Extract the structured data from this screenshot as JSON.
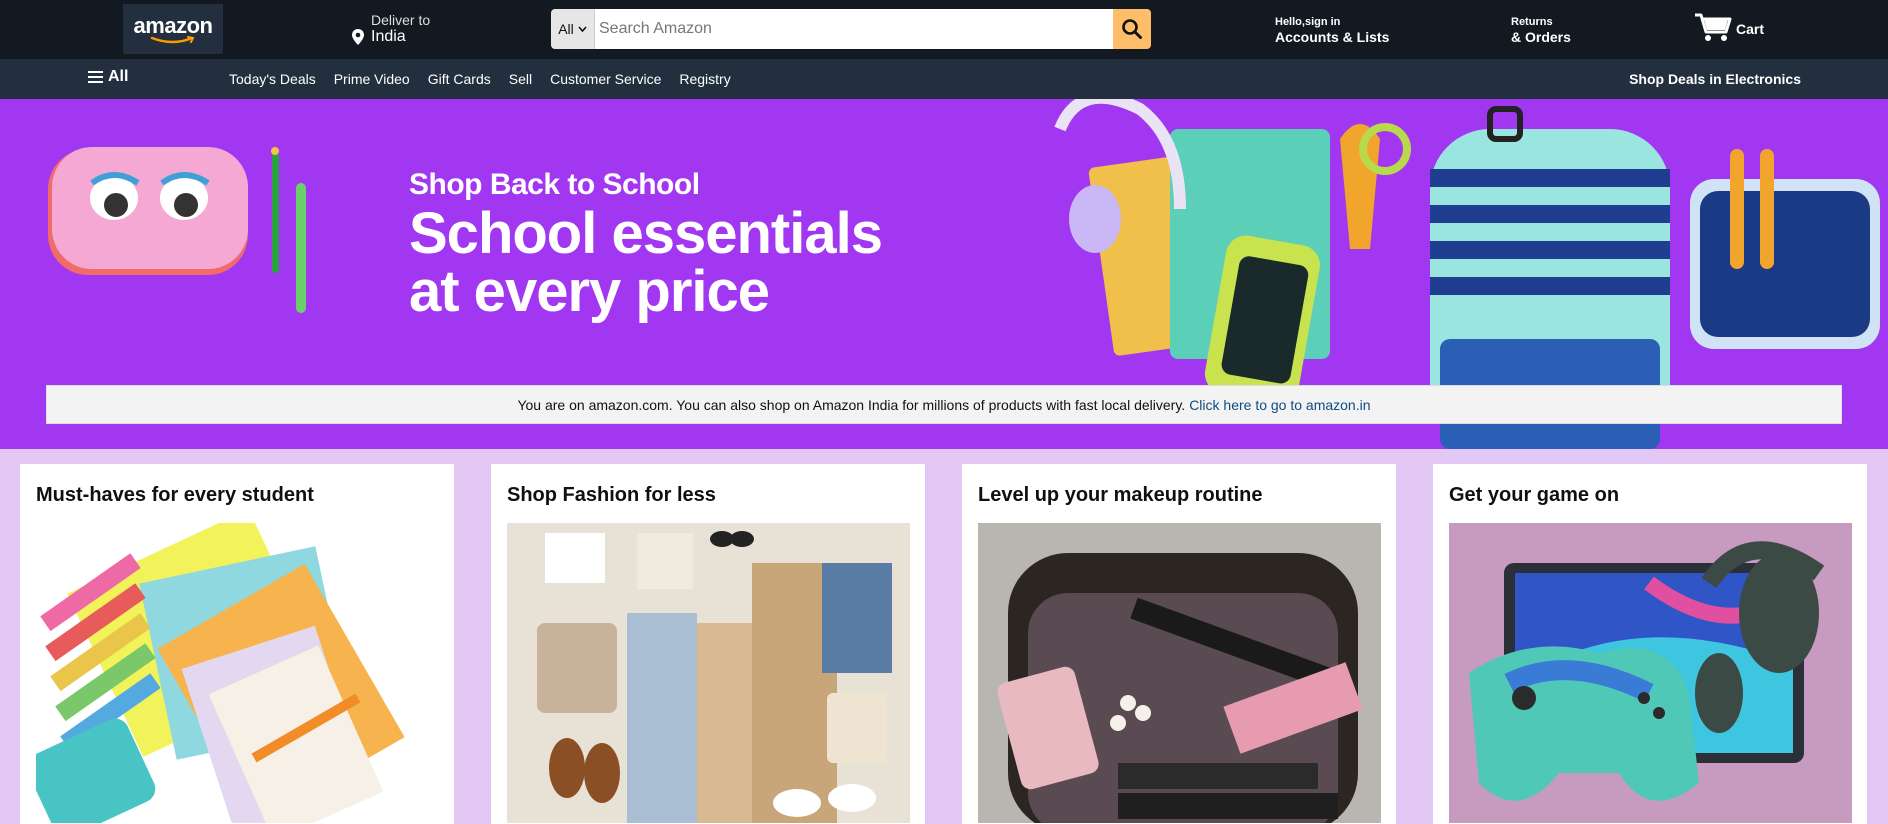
{
  "header": {
    "logo_text": "amazon",
    "deliver_label": "Deliver to",
    "deliver_location": "India",
    "search": {
      "category": "All",
      "placeholder": "Search Amazon"
    },
    "account_greeting": "Hello,sign in",
    "account_label": "Accounts & Lists",
    "returns_label": "Returns",
    "orders_label": "& Orders",
    "cart_label": "Cart"
  },
  "subnav": {
    "all_label": "All",
    "links": [
      "Today's Deals",
      "Prime Video",
      "Gift Cards",
      "Sell",
      "Customer Service",
      "Registry"
    ],
    "promo": "Shop Deals in Electronics"
  },
  "hero": {
    "kicker": "Shop Back to School",
    "title": "School essentials at every price",
    "background": "#a237f2"
  },
  "notice": {
    "text": "You are on amazon.com. You can also shop on Amazon India for millions of products with fast local delivery.",
    "link": "Click here to go to amazon.in"
  },
  "cards": [
    {
      "title": "Must-haves for every student"
    },
    {
      "title": "Shop Fashion for less"
    },
    {
      "title": "Level up your makeup routine"
    },
    {
      "title": "Get your game on"
    }
  ],
  "colors": {
    "header_bg": "#131921",
    "subnav_bg": "#232f3e",
    "search_button": "#febd69",
    "page_bg": "#e3c8f5"
  }
}
